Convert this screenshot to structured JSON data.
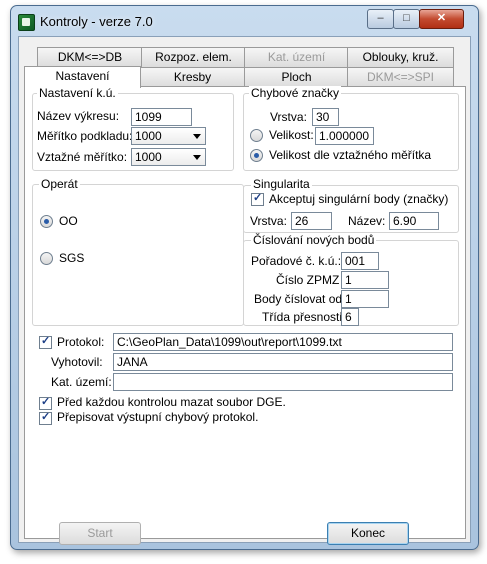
{
  "window": {
    "title": "Kontroly - verze 7.0",
    "controls": {
      "minimize": "–",
      "maximize": "□",
      "close": "✕"
    }
  },
  "tabs": {
    "row1": [
      {
        "label": "DKM<=>DB",
        "disabled": false
      },
      {
        "label": "Rozpoz. elem.",
        "disabled": false
      },
      {
        "label": "Kat. území",
        "disabled": true
      },
      {
        "label": "Oblouky, kruž.",
        "disabled": false
      }
    ],
    "row2": [
      {
        "label": "Nastavení",
        "disabled": false,
        "active": true
      },
      {
        "label": "Kresby",
        "disabled": false
      },
      {
        "label": "Ploch",
        "disabled": false
      },
      {
        "label": "DKM<=>SPI",
        "disabled": true
      }
    ]
  },
  "nastaveni_ku": {
    "title": "Nastavení k.ú.",
    "nazev_label": "Název výkresu:",
    "nazev_value": "1099",
    "meritko_label": "Měřítko podkladu:",
    "meritko_value": "1000",
    "vztazne_label": "Vztažné měřítko:",
    "vztazne_value": "1000"
  },
  "operat": {
    "title": "Operát",
    "option_oo": "OO",
    "option_sgs": "SGS",
    "selected": "OO"
  },
  "chybove": {
    "title": "Chybové značky",
    "vrstva_label": "Vrstva:",
    "vrstva_value": "30",
    "velikost_label": "Velikost:",
    "velikost_value": "1.000000",
    "dle_label": "Velikost dle vztažného měřítka",
    "selected": "dle"
  },
  "singularita": {
    "title": "Singularita",
    "akceptuj_label": "Akceptuj singulární body (značky)",
    "akceptuj_checked": true,
    "vrstva_label": "Vrstva:",
    "vrstva_value": "26",
    "nazev_label": "Název:",
    "nazev_value": "6.90"
  },
  "cislovani": {
    "title": "Číslování nových bodů",
    "poradove_label": "Pořadové č. k.ú.:",
    "poradove_value": "001",
    "zpmz_label": "Číslo ZPMZ",
    "zpmz_value": "1",
    "od_label": "Body číslovat od",
    "od_value": "1",
    "trida_label": "Třída přesnosti",
    "trida_value": "6"
  },
  "protokol": {
    "label": "Protokol:",
    "checked": true,
    "value": "C:\\GeoPlan_Data\\1099\\out\\report\\1099.txt",
    "vyhotovil_label": "Vyhotovil:",
    "vyhotovil_value": "JANA",
    "kat_label": "Kat. území:",
    "kat_value": ""
  },
  "options": {
    "mazat_label": "Před každou kontrolou mazat soubor DGE.",
    "mazat_checked": true,
    "prepisovat_label": "Přepisovat výstupní chybový protokol.",
    "prepisovat_checked": true
  },
  "buttons": {
    "start": "Start",
    "konec": "Konec"
  }
}
